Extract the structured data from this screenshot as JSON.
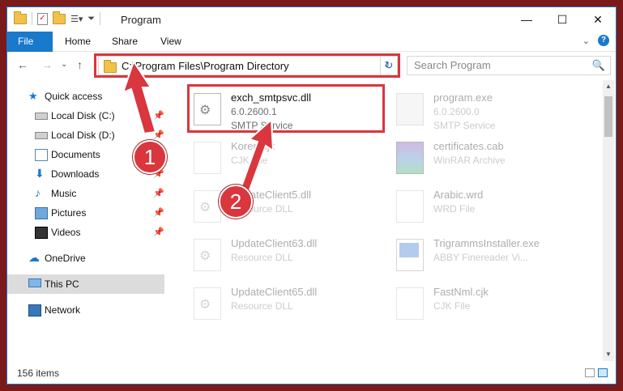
{
  "window": {
    "title": "Program",
    "controls": {
      "minimize": "—",
      "maximize": "☐",
      "close": "✕"
    }
  },
  "ribbon": {
    "tabs": [
      "File",
      "Home",
      "Share",
      "View"
    ],
    "expand_glyph": "⌄",
    "help_glyph": "?"
  },
  "nav": {
    "back": "←",
    "forward": "→",
    "history": "⌄",
    "up": "↑",
    "address": "C:\\Program Files\\Program Directory",
    "dropdown": "⌄",
    "refresh": "↻",
    "search_placeholder": "Search Program",
    "search_icon": "🔍"
  },
  "sidebar": {
    "items": [
      {
        "label": "Quick access",
        "icon": "star-icon",
        "glyph": "★",
        "pinned": false
      },
      {
        "label": "Local Disk (C:)",
        "icon": "disk-icon",
        "glyph": "",
        "pinned": true
      },
      {
        "label": "Local Disk (D:)",
        "icon": "disk-icon",
        "glyph": "",
        "pinned": true
      },
      {
        "label": "Documents",
        "icon": "documents-icon",
        "glyph": "",
        "pinned": true
      },
      {
        "label": "Downloads",
        "icon": "downloads-icon",
        "glyph": "⬇",
        "pinned": true
      },
      {
        "label": "Music",
        "icon": "music-icon",
        "glyph": "♪",
        "pinned": true
      },
      {
        "label": "Pictures",
        "icon": "pictures-icon",
        "glyph": "",
        "pinned": true
      },
      {
        "label": "Videos",
        "icon": "videos-icon",
        "glyph": "",
        "pinned": true
      },
      {
        "label": "OneDrive",
        "icon": "onedrive-icon",
        "glyph": "☁",
        "pinned": false
      },
      {
        "label": "This PC",
        "icon": "pc-icon",
        "glyph": "",
        "pinned": false
      },
      {
        "label": "Network",
        "icon": "network-icon",
        "glyph": "",
        "pinned": false
      }
    ],
    "pin_glyph": "📌"
  },
  "files": [
    {
      "name": "exch_smtpsvc.dll",
      "line1": "6.0.2600.1",
      "line2": "SMTP Service",
      "icon": "gear-doc-icon"
    },
    {
      "name": "program.exe",
      "line1": "6.0.2600.0",
      "line2": "SMTP Service",
      "icon": "exe-icon"
    },
    {
      "name": "Koren.cjk",
      "line1": "CJK File",
      "line2": "",
      "icon": "blank-doc-icon"
    },
    {
      "name": "certificates.cab",
      "line1": "WinRAR Archive",
      "line2": "",
      "icon": "rar-icon"
    },
    {
      "name": "UpdateClient5.dll",
      "line1": "Resource DLL",
      "line2": "",
      "icon": "gear-doc-icon"
    },
    {
      "name": "Arabic.wrd",
      "line1": "WRD File",
      "line2": "",
      "icon": "blank-doc-icon"
    },
    {
      "name": "UpdateClient63.dll",
      "line1": "Resource DLL",
      "line2": "",
      "icon": "gear-doc-icon"
    },
    {
      "name": "TrigrammsInstaller.exe",
      "line1": "ABBY Finereader Vi...",
      "line2": "",
      "icon": "installer-icon"
    },
    {
      "name": "UpdateClient65.dll",
      "line1": "Resource DLL",
      "line2": "",
      "icon": "gear-doc-icon"
    },
    {
      "name": "FastNml.cjk",
      "line1": "CJK File",
      "line2": "",
      "icon": "blank-doc-icon"
    }
  ],
  "status": {
    "count": "156 items"
  },
  "annotations": {
    "step1": "1",
    "step2": "2"
  },
  "colors": {
    "accent": "#1979ca",
    "highlight_red": "#d9363e",
    "selected_nav": "#dcdcdc"
  }
}
